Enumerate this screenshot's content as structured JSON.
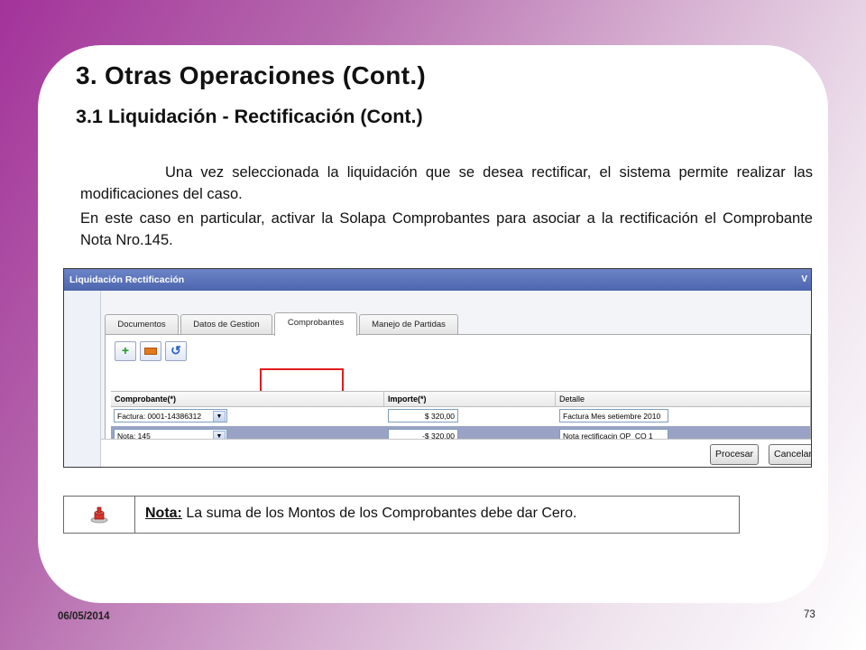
{
  "slide": {
    "title": "3. Otras Operaciones (Cont.)",
    "subtitle": "3.1 Liquidación - Rectificación (Cont.)",
    "paragraph1": "Una vez seleccionada la liquidación que se desea rectificar, el sistema permite realizar las modificaciones del caso.",
    "paragraph2": "En este caso en particular, activar la Solapa Comprobantes para asociar a la rectificación el Comprobante Nota Nro.145.",
    "date": "06/05/2014",
    "page_number": "73",
    "colors": {
      "background_gradient_start": "#a3339a",
      "highlight_box": "#e21b1b",
      "selected_row": "#9aa3c5"
    }
  },
  "window": {
    "title": "Liquidación Rectificación",
    "title_right": "V",
    "tabs": [
      {
        "label": "Documentos",
        "active": false
      },
      {
        "label": "Datos de Gestion",
        "active": false
      },
      {
        "label": "Comprobantes",
        "active": true
      },
      {
        "label": "Manejo de Partidas",
        "active": false
      }
    ],
    "toolbar": {
      "add_icon": "plus-icon",
      "remove_icon": "minus-icon",
      "undo_icon": "undo-icon"
    },
    "grid": {
      "headers": [
        "Comprobante(*)",
        "Importe(*)",
        "Detalle"
      ],
      "rows": [
        {
          "comprobante": "Factura: 0001-14386312",
          "importe": "$ 320,00",
          "detalle": "Factura Mes setiembre 2010",
          "selected": false
        },
        {
          "comprobante": "Nota: 145",
          "importe": "-$ 320,00",
          "detalle": "Nota rectificacin OP_CO 1",
          "selected": true
        }
      ]
    },
    "buttons": {
      "procesar": "Procesar",
      "cancelar": "Cancelar"
    }
  },
  "note": {
    "icon": "note-pin-icon",
    "label": "Nota:",
    "text": " La suma de los Montos de los Comprobantes debe dar Cero."
  }
}
